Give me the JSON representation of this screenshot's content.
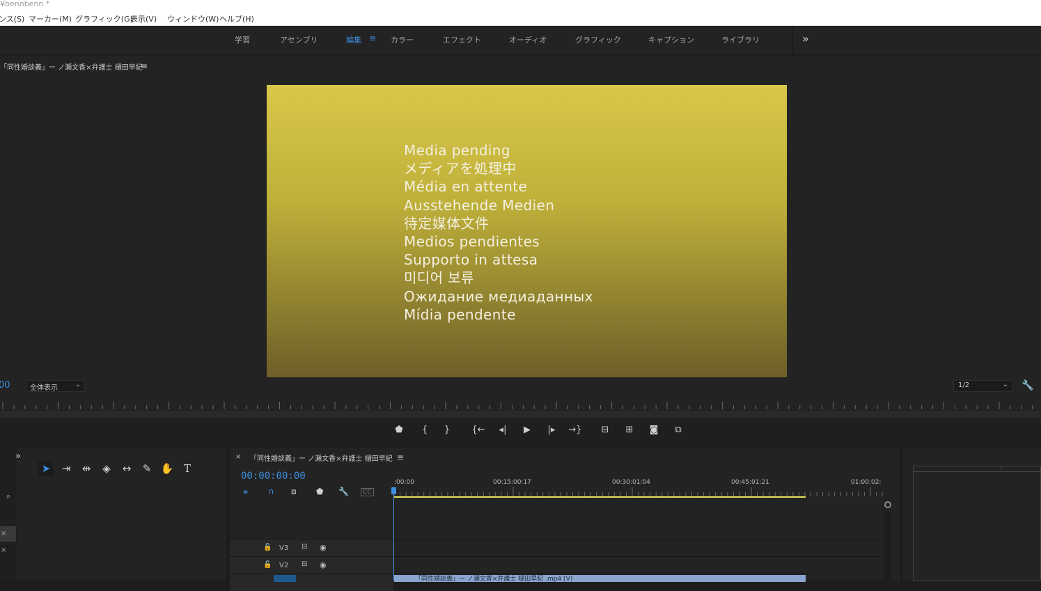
{
  "window": {
    "title": "¥bennbenn *"
  },
  "menu": [
    "ンス(S)",
    "マーカー(M)",
    "グラフィック(G)",
    "表示(V)",
    "ウィンドウ(W)",
    "ヘルプ(H)"
  ],
  "workspaces": {
    "tabs": [
      "学習",
      "アセンブリ",
      "編集",
      "カラー",
      "エフェクト",
      "オーディオ",
      "グラフィック",
      "キャプション",
      "ライブラリ"
    ],
    "active": "編集",
    "more_icon": "»"
  },
  "program_monitor": {
    "title": "「同性婚談義」ー ノ瀬文香×弁護士 樋田早紀",
    "menu_icon": "≡",
    "pending_lines": [
      "Media pending",
      "メディアを処理中",
      "Média en attente",
      "Ausstehende Medien",
      "待定媒体文件",
      "Medios pendientes",
      "Supporto in attesa",
      "미디어 보류",
      "Ожидание медиаданных",
      "Mídia pendente"
    ],
    "timecode_fragment": "00",
    "zoom": "全体表示",
    "resolution": "1/2",
    "frame_gradient": {
      "top": "#d9c74a",
      "bottom": "#6d5f28"
    }
  },
  "transport": {
    "buttons": [
      "marker-icon",
      "mark-in-icon",
      "mark-out-icon",
      "go-to-in-icon",
      "step-back-icon",
      "play-icon",
      "step-forward-icon",
      "go-to-out-icon",
      "lift-icon",
      "extract-icon",
      "export-frame-icon",
      "comparison-view-icon"
    ]
  },
  "tools": {
    "project_more": "»",
    "items": [
      "selection-tool-icon",
      "track-select-tool-icon",
      "ripple-edit-tool-icon",
      "razor-tool-icon",
      "slip-tool-icon",
      "pen-tool-icon",
      "hand-tool-icon",
      "type-tool-icon"
    ]
  },
  "timeline": {
    "close": "×",
    "sequence_name": "「同性婚談義」ー ノ瀬文香×弁護士 樋田早紀",
    "menu_icon": "≡",
    "timecode": "00:00:00:00",
    "ruler_labels": [
      ":00:00",
      "00:15:00:17",
      "00:30:01:04",
      "00:45:01:21",
      "01:00:02:"
    ],
    "tracks": [
      {
        "name": "V3"
      },
      {
        "name": "V2"
      }
    ],
    "clip_label": "「同性婚談義」ー ノ瀬文香×弁護士 樋田早紀 .mp4 [V]",
    "accent_color": "#3d8ee0",
    "work_area_color": "#e8e15a"
  }
}
